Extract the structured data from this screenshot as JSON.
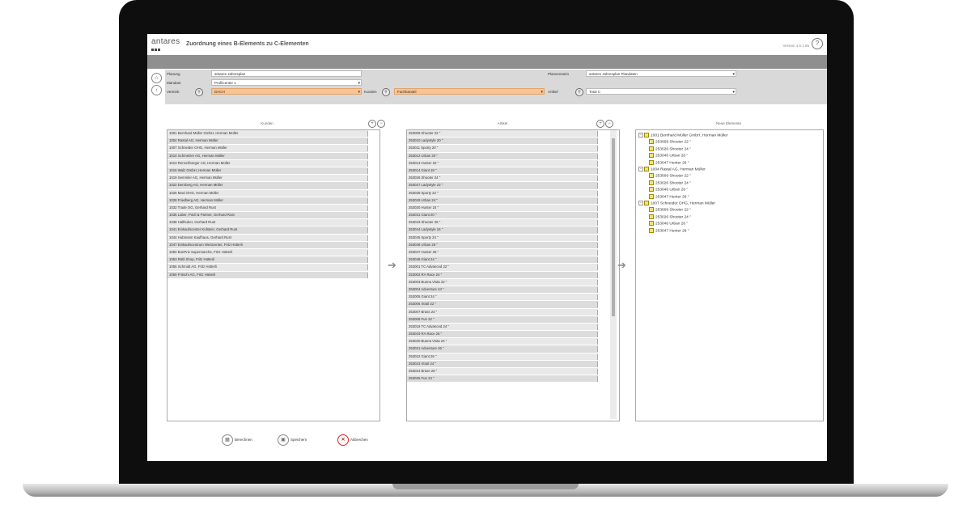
{
  "app": {
    "logo": "antares",
    "title": "Zuordnung eines B-Elements zu C-Elementen",
    "version": "Version 4.5.1.65",
    "help_label": "?"
  },
  "filters": {
    "planung_label": "Planung",
    "planung_value": "antares Jahresplan",
    "mandant_label": "Mandant",
    "mandant_value": "Profitcenter 1",
    "vertrieb_label": "Vertrieb",
    "vertrieb_value": "DACH",
    "kunden_label": "Kunden",
    "kunden_value": "Fachhandel",
    "planszenario_label": "Planszenario",
    "planszenario_value": "antares Jahresplan Plandaten",
    "artikel_label": "Artikel",
    "artikel_value": "Total C"
  },
  "kunden": {
    "header": "Kunden",
    "items": [
      "1001 Bernhard Müller GmbH, Herman Müller",
      "1004 Rastal AG, Herman Müller",
      "1007 Schneider OHG, Herman Müller",
      "1010 Schmelzer AG, Herman Müller",
      "1013 Renschberger AG, Herman Müller",
      "1016 Walz GmbH, Herman Müller",
      "1019 Semmler AG, Herman Müller",
      "1022 Dernberg AG, Herman Müller",
      "1025 Maxi OHG, Herman Müller",
      "1028 Friedberg AG, Herman Müller",
      "1032 Trade OG, Gerhard Rust",
      "1035 Laber, Potzl & Partner, Gerhard Rust",
      "1038 Hallhuber, Gerhard Rust",
      "1041 Einkaufscenter Kufstein, Gerhard Rust",
      "1044 Hubmann Kaufhaus, Gerhard Rust",
      "1047 Einkaufscentrum Westcenter, Fritz Hütterli",
      "1050 BonPrix Supermarche, Fritz Hütterli",
      "1053 Rütli Shop, Fritz Hütterli",
      "1056 Schmidt AG, Fritz Hütterli",
      "1059 Fritschi AG, Fritz Hütterli"
    ]
  },
  "artikel": {
    "header": "Artikel",
    "items": [
      "253009 Shooter 22 \"",
      "253010 Ladystyle 20 \"",
      "253011 Sporty 20 \"",
      "253012 Urban 20 \"",
      "253013 Hunter 22 \"",
      "253014 Giant 18 \"",
      "253026 Shooter 24 \"",
      "253027 Ladystyle 22 \"",
      "253028 Sporty 22 \"",
      "253029 Urban 24 \"",
      "253030 Hunter 24 \"",
      "253031 Giant 20 \"",
      "253043 Shooter 26 \"",
      "253044 Ladystyle 24 \"",
      "253045 Sporty 24 \"",
      "253046 Urban 26 \"",
      "253047 Hunter 26 \"",
      "253048 Giant 24 \"",
      "253001 TC Advanced 22 \"",
      "253002 RA Race 24 \"",
      "253003 Buena Vista 22 \"",
      "253004 Adventure 24 \"",
      "253005 Giant 24 \"",
      "253006 Xtrail 22 \"",
      "253007 Brass 24 \"",
      "253008 Fun 22 \"",
      "253018 TC Advanced 24 \"",
      "253019 RA Race 26 \"",
      "253020 Buena Vista 24 \"",
      "253021 Adventure 26 \"",
      "253022 Giant 26 \"",
      "253023 Xtrail 24 \"",
      "253024 Brass 26 \"",
      "253025 Fun 24 \""
    ]
  },
  "neue": {
    "header": "Neue Elemente",
    "groups": [
      {
        "label": "1001 Bernhard Müller GmbH, Herman Müller",
        "children": [
          "253009 Shooter 22 \"",
          "253026 Shooter 24 \"",
          "253046 Urban 26 \"",
          "253047 Hunter 26 \""
        ]
      },
      {
        "label": "1004 Rastal AG, Herman Müller",
        "children": [
          "253009 Shooter 22 \"",
          "253026 Shooter 24 \"",
          "253046 Urban 26 \"",
          "253047 Hunter 26 \""
        ]
      },
      {
        "label": "1007 Schneider OHG, Herman Müller",
        "children": [
          "253009 Shooter 22 \"",
          "253026 Shooter 24 \"",
          "253046 Urban 26 \"",
          "253047 Hunter 26 \""
        ]
      }
    ]
  },
  "footer": {
    "berechnen": "Berechnen",
    "speichern": "Speichern",
    "abbrechen": "Abbrechen"
  }
}
